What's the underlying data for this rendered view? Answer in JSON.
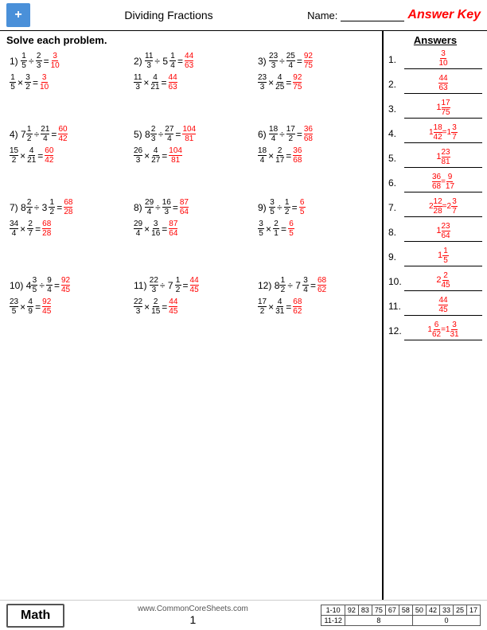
{
  "header": {
    "title": "Dividing Fractions",
    "name_label": "Name:",
    "answer_key": "Answer Key"
  },
  "instruction": "Solve each problem.",
  "answers": {
    "title": "Answers",
    "items": [
      {
        "num": "1.",
        "value": "3/10"
      },
      {
        "num": "2.",
        "value": "44/63"
      },
      {
        "num": "3.",
        "value": "1 17/75"
      },
      {
        "num": "4.",
        "value": "1 18/42 = 1 3/7"
      },
      {
        "num": "5.",
        "value": "1 23/81"
      },
      {
        "num": "6.",
        "value": "36/68 = 9/17"
      },
      {
        "num": "7.",
        "value": "2 12/28 = 2 3/7"
      },
      {
        "num": "8.",
        "value": "1 23/64"
      },
      {
        "num": "9.",
        "value": "1 1/5"
      },
      {
        "num": "10.",
        "value": "2 2/45"
      },
      {
        "num": "11.",
        "value": "44/45"
      },
      {
        "num": "12.",
        "value": "1 6/62 = 1 3/31"
      }
    ]
  },
  "footer": {
    "math_label": "Math",
    "url": "www.CommonCoreSheets.com",
    "page": "1",
    "score_rows": [
      {
        "label": "1-10",
        "values": [
          "92",
          "83",
          "75",
          "67",
          "58",
          "50",
          "42",
          "33",
          "25",
          "17"
        ]
      },
      {
        "label": "11-12",
        "values": [
          "8",
          "0"
        ]
      }
    ]
  }
}
